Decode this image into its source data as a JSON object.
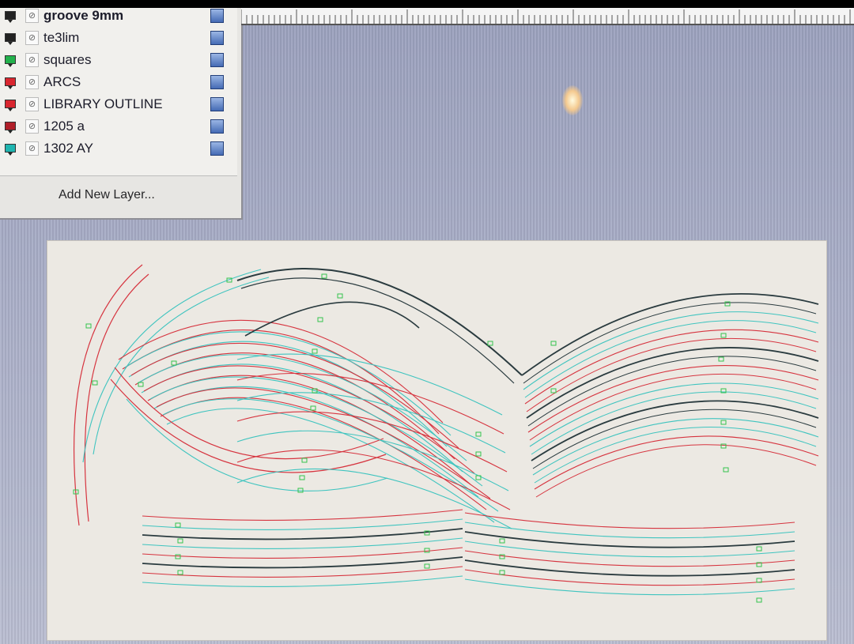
{
  "layers_panel": {
    "layers": [
      {
        "name": "groove 9mm",
        "color": "#222222",
        "bold": true
      },
      {
        "name": "te3lim",
        "color": "#222222",
        "bold": false
      },
      {
        "name": "squares",
        "color": "#22b14c",
        "bold": false
      },
      {
        "name": "ARCS",
        "color": "#d9262f",
        "bold": false
      },
      {
        "name": "LIBRARY OUTLINE",
        "color": "#d9262f",
        "bold": false
      },
      {
        "name": "1205 a",
        "color": "#b01e28",
        "bold": false
      },
      {
        "name": "1302 AY",
        "color": "#1fb5b0",
        "bold": false
      }
    ],
    "add_layer_label": "Add New Layer..."
  },
  "icons": {
    "layer_visibility": "layer-visibility-icon",
    "layer_lock": "layer-lock-icon",
    "layer_color": "layer-color-swatch"
  },
  "colors": {
    "red_path": "#d6343f",
    "cyan_path": "#3fc4bf",
    "dark_path": "#2a3b3f",
    "square_marker": "#33c44d"
  }
}
